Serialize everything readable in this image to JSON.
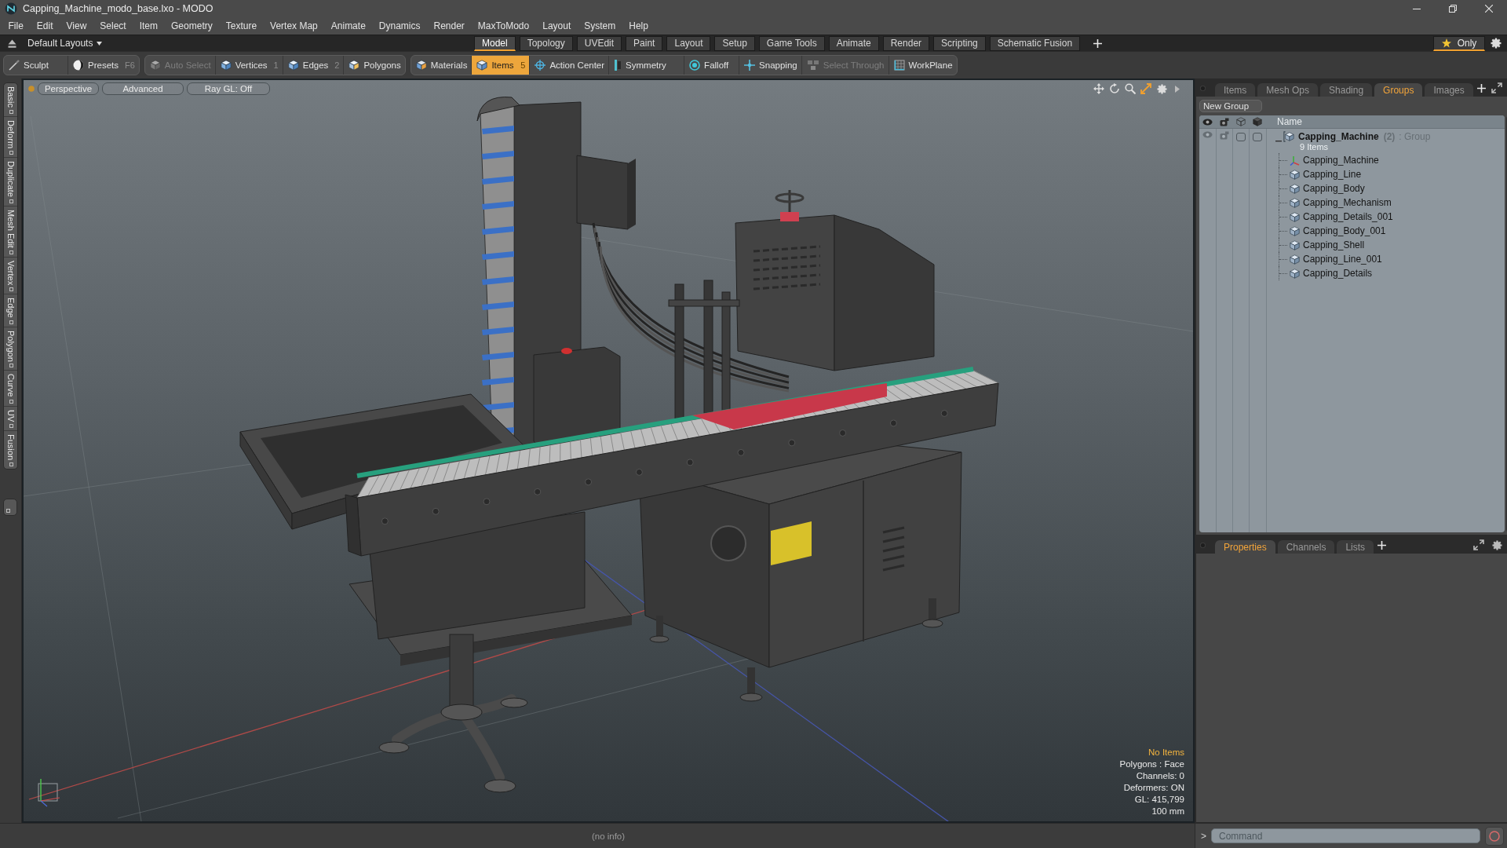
{
  "window": {
    "title": "Capping_Machine_modo_base.lxo - MODO"
  },
  "menu": [
    "File",
    "Edit",
    "View",
    "Select",
    "Item",
    "Geometry",
    "Texture",
    "Vertex Map",
    "Animate",
    "Dynamics",
    "Render",
    "MaxToModo",
    "Layout",
    "System",
    "Help"
  ],
  "layout_bar": {
    "preset": "Default Layouts",
    "tabs": [
      {
        "label": "Model",
        "selected": true
      },
      {
        "label": "Topology",
        "selected": false
      },
      {
        "label": "UVEdit",
        "selected": false
      },
      {
        "label": "Paint",
        "selected": false
      },
      {
        "label": "Layout",
        "selected": false
      },
      {
        "label": "Setup",
        "selected": false
      },
      {
        "label": "Game Tools",
        "selected": false
      },
      {
        "label": "Animate",
        "selected": false
      },
      {
        "label": "Render",
        "selected": false
      },
      {
        "label": "Scripting",
        "selected": false
      },
      {
        "label": "Schematic Fusion",
        "selected": false
      }
    ],
    "only_button": {
      "label": "Only",
      "on": true
    }
  },
  "toolbar": {
    "groups": [
      [
        {
          "label": "Sculpt",
          "selected": false,
          "disabled": false
        },
        {
          "label": "Presets",
          "shortcut": "F6",
          "selected": false,
          "disabled": false
        }
      ],
      [
        {
          "label": "Auto Select",
          "selected": false,
          "disabled": true
        },
        {
          "label": "Vertices",
          "shortcut": "1",
          "selected": false,
          "disabled": false
        },
        {
          "label": "Edges",
          "shortcut": "2",
          "selected": false,
          "disabled": false
        },
        {
          "label": "Polygons",
          "selected": false,
          "disabled": false
        }
      ],
      [
        {
          "label": "Materials",
          "selected": false,
          "disabled": false
        },
        {
          "label": "Items",
          "shortcut": "5",
          "selected": true,
          "disabled": false
        },
        {
          "label": "Action Center",
          "selected": false,
          "disabled": false
        },
        {
          "label": "Symmetry",
          "selected": false,
          "disabled": false
        },
        {
          "label": "Falloff",
          "selected": false,
          "disabled": false
        },
        {
          "label": "Snapping",
          "selected": false,
          "disabled": false
        },
        {
          "label": "Select Through",
          "selected": false,
          "disabled": true
        },
        {
          "label": "WorkPlane",
          "selected": false,
          "disabled": false
        }
      ]
    ]
  },
  "side_tabs": [
    "Basic",
    "Deform",
    "Duplicate",
    "Mesh Edit",
    "Vertex",
    "Edge",
    "Polygon",
    "Curve",
    "UV",
    "Fusion"
  ],
  "viewport": {
    "buttons": [
      "Perspective",
      "Advanced",
      "Ray GL: Off"
    ],
    "info": [
      {
        "text": "No Items",
        "highlight": true
      },
      {
        "text": "Polygons : Face",
        "highlight": false
      },
      {
        "text": "Channels: 0",
        "highlight": false
      },
      {
        "text": "Deformers: ON",
        "highlight": false
      },
      {
        "text": "GL: 415,799",
        "highlight": false
      },
      {
        "text": "100 mm",
        "highlight": false
      }
    ]
  },
  "item_panel": {
    "tabs": [
      {
        "label": "Items",
        "selected": false
      },
      {
        "label": "Mesh Ops",
        "selected": false
      },
      {
        "label": "Shading",
        "selected": false
      },
      {
        "label": "Groups",
        "selected": true
      },
      {
        "label": "Images",
        "selected": false
      }
    ],
    "new_group_button": "New Group",
    "name_header": "Name",
    "group": {
      "name": "Capping_Machine",
      "count": "(2)",
      "type": ": Group",
      "summary": "9 Items",
      "expanded": true,
      "toggles": [
        {
          "checked": false
        },
        {
          "checked": false
        }
      ],
      "children": [
        {
          "name": "Capping_Machine",
          "kind": "locator"
        },
        {
          "name": "Capping_Line",
          "kind": "mesh"
        },
        {
          "name": "Capping_Body",
          "kind": "mesh"
        },
        {
          "name": "Capping_Mechanism",
          "kind": "mesh"
        },
        {
          "name": "Capping_Details_001",
          "kind": "mesh"
        },
        {
          "name": "Capping_Body_001",
          "kind": "mesh"
        },
        {
          "name": "Capping_Shell",
          "kind": "mesh"
        },
        {
          "name": "Capping_Line_001",
          "kind": "mesh"
        },
        {
          "name": "Capping_Details",
          "kind": "mesh"
        }
      ]
    }
  },
  "properties_panel": {
    "tabs": [
      {
        "label": "Properties",
        "selected": true
      },
      {
        "label": "Channels",
        "selected": false
      },
      {
        "label": "Lists",
        "selected": false
      }
    ]
  },
  "status_bar": {
    "text": "(no info)"
  },
  "command": {
    "prompt": ">",
    "placeholder": "Command"
  }
}
